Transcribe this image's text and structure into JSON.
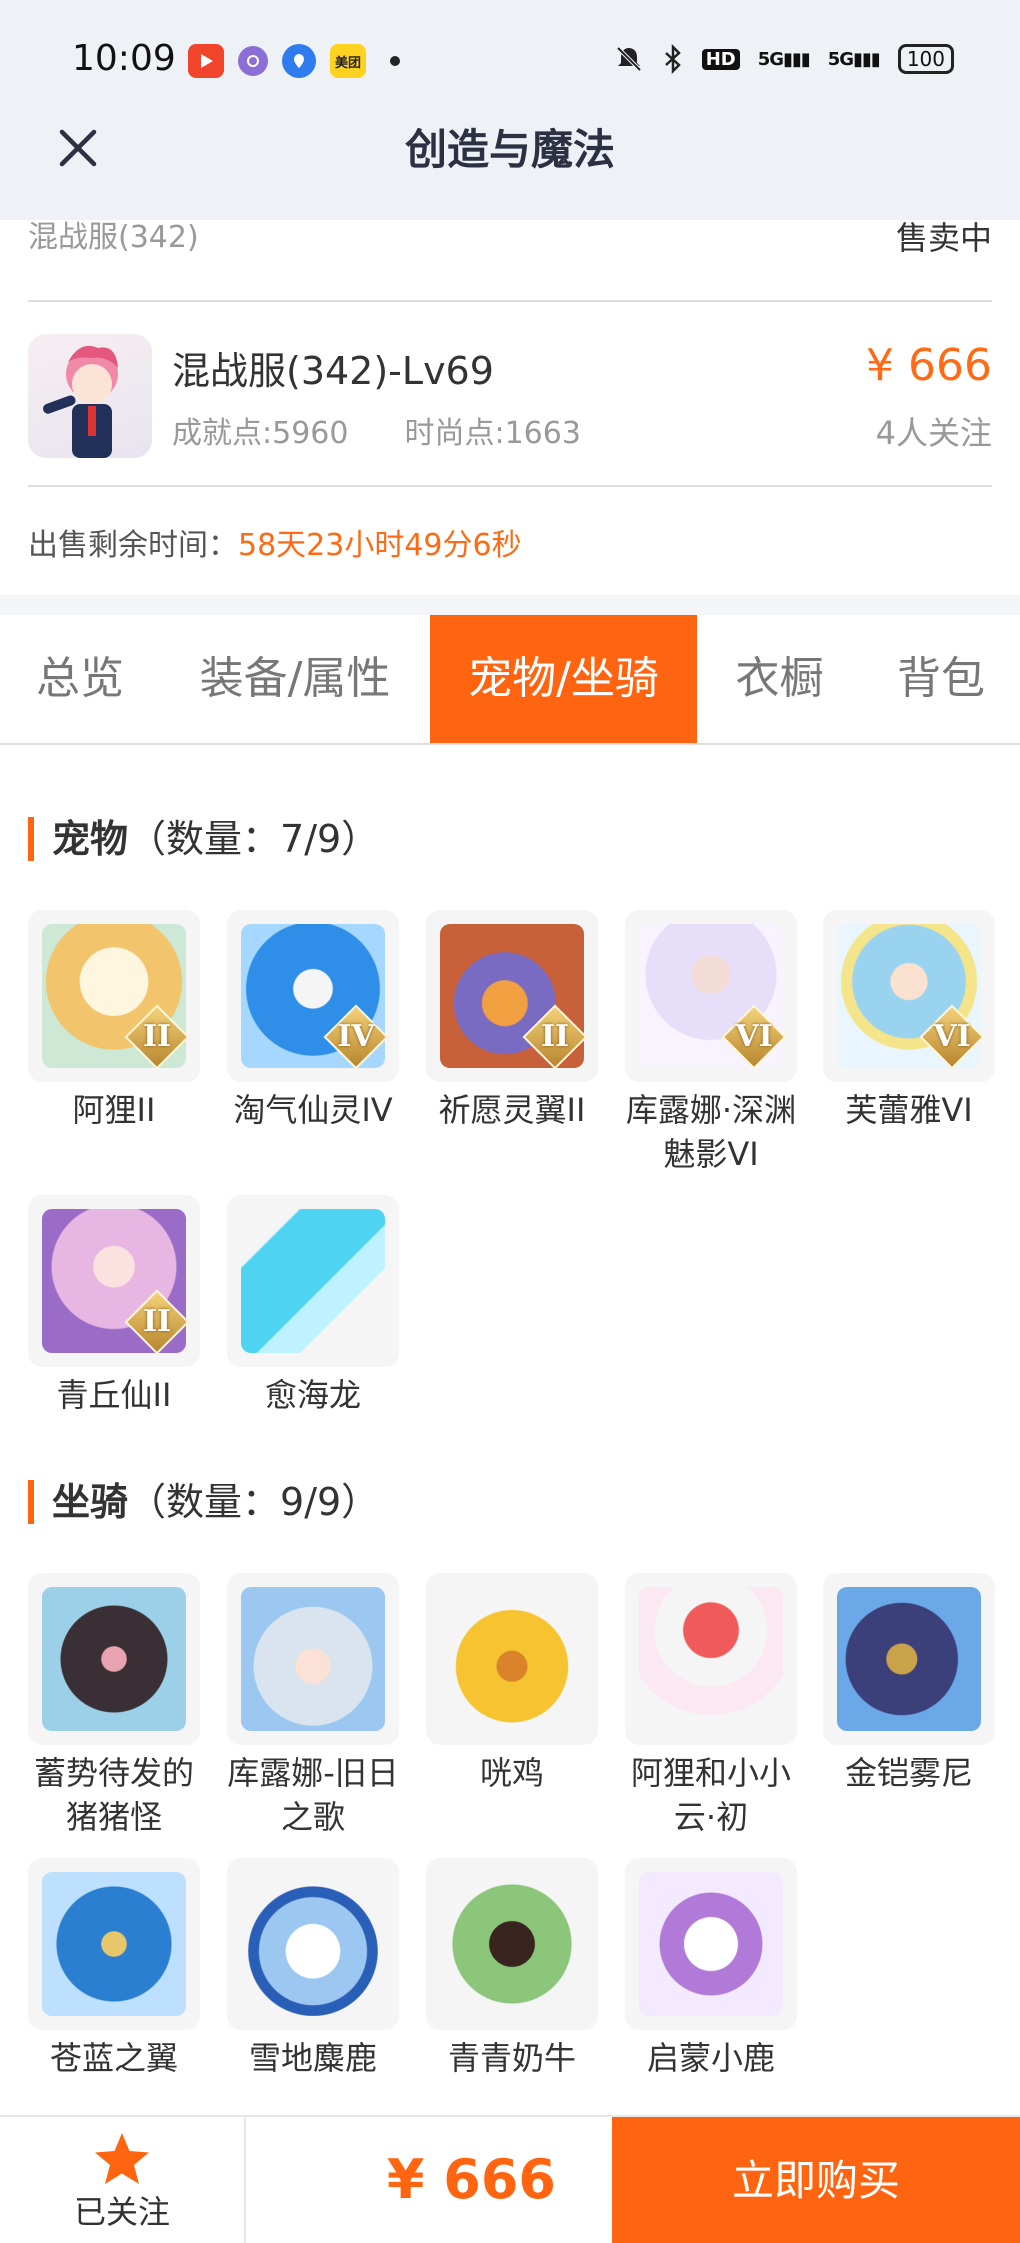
{
  "status_bar": {
    "time": "10:09",
    "apps": [
      "video-app",
      "browser-app",
      "map-app",
      "美团"
    ],
    "network": [
      "5G",
      "5G"
    ],
    "hd": "HD",
    "battery": "100"
  },
  "nav": {
    "title": "创造与魔法"
  },
  "listing": {
    "server": "混战服(342)",
    "status": "售卖中",
    "character_name": "混战服(342)-Lv69",
    "achievement": "成就点:5960",
    "fashion": "时尚点:1663",
    "price": "¥ 666",
    "followers": "4人关注",
    "time_label": "出售剩余时间：",
    "time_value": "58天23小时49分6秒"
  },
  "tabs": [
    {
      "label": "总览",
      "active": false
    },
    {
      "label": "装备/属性",
      "active": false
    },
    {
      "label": "宠物/坐骑",
      "active": true
    },
    {
      "label": "衣橱",
      "active": false
    },
    {
      "label": "背包",
      "active": false
    }
  ],
  "pets": {
    "title": "宠物",
    "count": "（数量：7/9）",
    "items": [
      {
        "name": "阿狸II",
        "badge": "II",
        "color": "#f2c46b"
      },
      {
        "name": "淘气仙灵IV",
        "badge": "IV",
        "color": "#2f8fe8"
      },
      {
        "name": "祈愿灵翼II",
        "badge": "II",
        "color": "#c8603a"
      },
      {
        "name": "库露娜·深渊魅影VI",
        "badge": "VI",
        "color": "#e7defa"
      },
      {
        "name": "芙蕾雅VI",
        "badge": "VI",
        "color": "#9ad3f0"
      },
      {
        "name": "青丘仙II",
        "badge": "II",
        "color": "#e7b6e2"
      },
      {
        "name": "愈海龙",
        "badge": "",
        "color": "#4ed4f0"
      }
    ]
  },
  "mounts": {
    "title": "坐骑",
    "count": "（数量：9/9）",
    "items": [
      {
        "name": "蓄势待发的猪猪怪",
        "color": "#3a2f34"
      },
      {
        "name": "库露娜-旧日之歌",
        "color": "#d9e4ef"
      },
      {
        "name": "咣鸡",
        "color": "#f5c430"
      },
      {
        "name": "阿狸和小小云·初",
        "color": "#f05a5a"
      },
      {
        "name": "金铠雾尼",
        "color": "#3b3f7a"
      },
      {
        "name": "苍蓝之翼",
        "color": "#2b7fd1"
      },
      {
        "name": "雪地麋鹿",
        "color": "#9cc7f0"
      },
      {
        "name": "青青奶牛",
        "color": "#8cc67a"
      },
      {
        "name": "启蒙小鹿",
        "color": "#b27ad8"
      }
    ]
  },
  "bottom_bar": {
    "follow_label": "已关注",
    "price": "¥ 666",
    "buy_label": "立即购买"
  },
  "colors": {
    "accent": "#ff6410",
    "price": "#ff6a14",
    "nav_bg": "#eef2f7"
  }
}
